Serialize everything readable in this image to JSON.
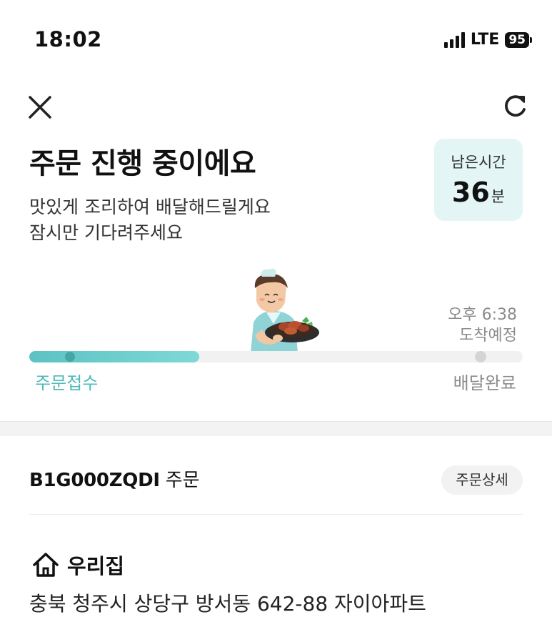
{
  "status_bar": {
    "time": "18:02",
    "network": "LTE",
    "battery": "95"
  },
  "header": {
    "close_icon": "close-icon",
    "refresh_icon": "refresh-icon"
  },
  "order_status": {
    "title": "주문 진행 중이에요",
    "message_line1": "맛있게 조리하여 배달해드릴게요",
    "message_line2": "잠시만 기다려주세요"
  },
  "remaining_time": {
    "label": "남은시간",
    "value": "36",
    "unit": "분"
  },
  "progress": {
    "eta_time": "오후 6:38",
    "eta_label": "도착예정",
    "start_label": "주문접수",
    "end_label": "배달완료",
    "fill_fraction": 0.345,
    "accent_color": "#5cc2c3"
  },
  "order": {
    "id": "B1G000ZQDI",
    "suffix": "주문",
    "detail_button": "주문상세"
  },
  "address": {
    "icon": "home-icon",
    "name": "우리집",
    "full": "충북 청주시 상당구 방서동 642-88 자이아파트"
  }
}
